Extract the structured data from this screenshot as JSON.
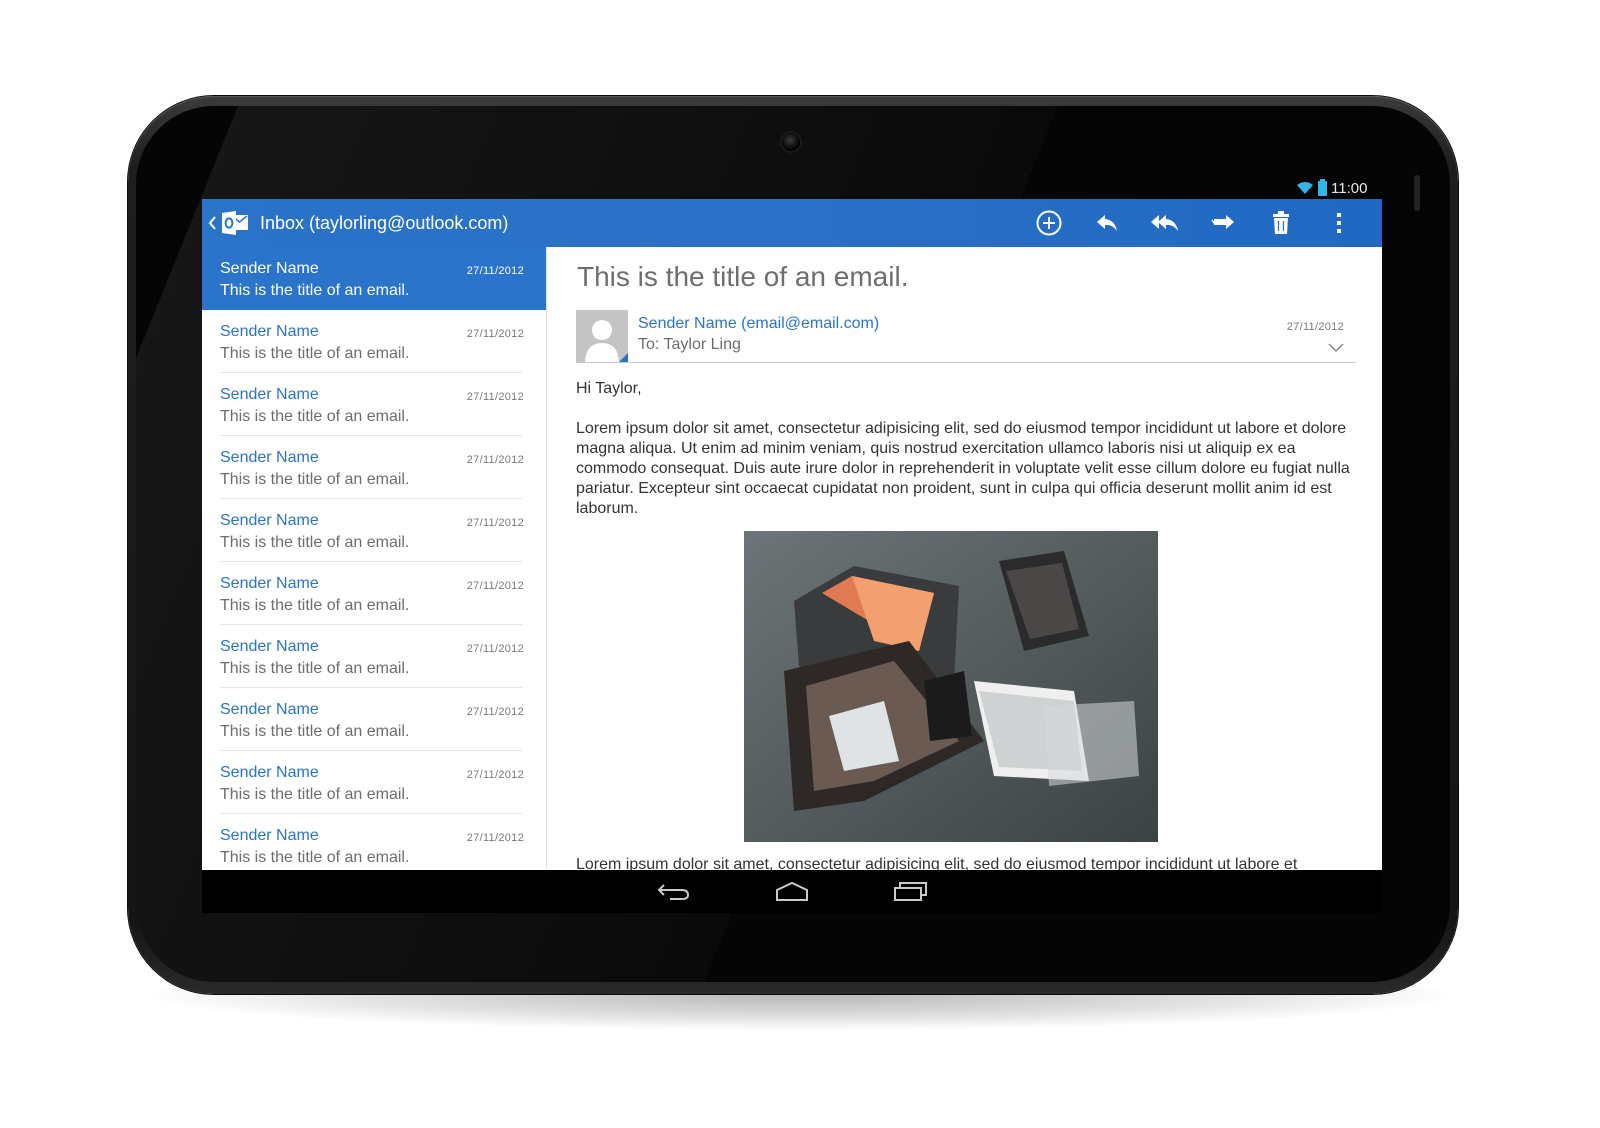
{
  "status_bar": {
    "time": "11:00"
  },
  "action_bar": {
    "title": "Inbox (taylorling@outlook.com)",
    "actions": [
      "compose-icon",
      "reply-icon",
      "reply-all-icon",
      "forward-icon",
      "delete-icon",
      "overflow-menu-icon"
    ]
  },
  "email_list": [
    {
      "sender": "Sender Name",
      "subject": "This is the title of an email.",
      "date": "27/11/2012",
      "selected": true
    },
    {
      "sender": "Sender Name",
      "subject": "This is the title of an email.",
      "date": "27/11/2012"
    },
    {
      "sender": "Sender Name",
      "subject": "This is the title of an email.",
      "date": "27/11/2012"
    },
    {
      "sender": "Sender Name",
      "subject": "This is the title of an email.",
      "date": "27/11/2012"
    },
    {
      "sender": "Sender Name",
      "subject": "This is the title of an email.",
      "date": "27/11/2012"
    },
    {
      "sender": "Sender Name",
      "subject": "This is the title of an email.",
      "date": "27/11/2012"
    },
    {
      "sender": "Sender Name",
      "subject": "This is the title of an email.",
      "date": "27/11/2012"
    },
    {
      "sender": "Sender Name",
      "subject": "This is the title of an email.",
      "date": "27/11/2012"
    },
    {
      "sender": "Sender Name",
      "subject": "This is the title of an email.",
      "date": "27/11/2012"
    },
    {
      "sender": "Sender Name",
      "subject": "This is the title of an email.",
      "date": "27/11/2012"
    }
  ],
  "reader": {
    "title": "This is the title of an email.",
    "from": "Sender Name (email@email.com)",
    "to": "To: Taylor Ling",
    "date": "27/11/2012",
    "greeting": "Hi Taylor,",
    "paragraph": "Lorem ipsum dolor sit amet, consectetur adipisicing elit, sed do eiusmod tempor incididunt ut labore et dolore magna aliqua. Ut enim ad minim veniam, quis nostrud exercitation ullamco laboris nisi ut aliquip ex ea commodo consequat. Duis aute irure dolor in reprehenderit in voluptate velit esse cillum dolore eu fugiat nulla pariatur. Excepteur sint occaecat cupidatat non proident, sunt in culpa qui officia deserunt mollit anim id est laborum.",
    "paragraph2": "Lorem ipsum dolor sit amet, consectetur adipisicing elit, sed do eiusmod tempor incididunt ut labore et"
  },
  "colors": {
    "accent": "#2a73c9",
    "selected_row": "#2b74cb",
    "status_icon": "#33b5e5"
  },
  "nav_bar": [
    "back-icon",
    "home-icon",
    "recent-apps-icon"
  ]
}
